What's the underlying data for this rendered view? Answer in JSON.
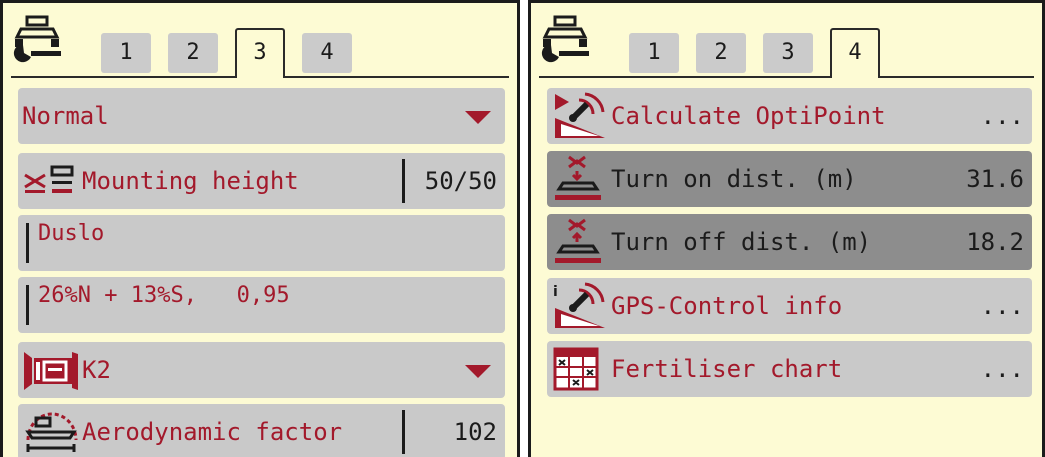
{
  "left_panel": {
    "tabs": [
      "1",
      "2",
      "3",
      "4"
    ],
    "active_tab": "3",
    "rows": {
      "mode": {
        "label": "Normal"
      },
      "mounting_height": {
        "label": "Mounting height",
        "value": "50/50"
      },
      "fertiliser_name": {
        "label": "Duslo"
      },
      "fertiliser_composition": {
        "label": "26%N + 13%S,   0,95"
      },
      "disc_type": {
        "label": "K2"
      },
      "aerodynamic_factor": {
        "label": "Aerodynamic factor",
        "value": "102"
      }
    }
  },
  "right_panel": {
    "tabs": [
      "1",
      "2",
      "3",
      "4"
    ],
    "active_tab": "4",
    "rows": {
      "calculate_optipoint": {
        "label": "Calculate OptiPoint",
        "value": "..."
      },
      "turn_on_dist": {
        "label": "Turn on dist. (m)",
        "value": "31.6"
      },
      "turn_off_dist": {
        "label": "Turn off dist. (m)",
        "value": "18.2"
      },
      "gps_control_info": {
        "label": "GPS-Control info",
        "value": "..."
      },
      "fertiliser_chart": {
        "label": "Fertiliser chart",
        "value": "..."
      }
    }
  },
  "colors": {
    "background": "#fdfbd4",
    "row": "#c9c9c9",
    "row_selected": "#8d8d8d",
    "accent_red": "#a3192b",
    "text_dark": "#1b1b1b"
  },
  "icons": {
    "tab_logo": "spreader-settings-icon",
    "mounting_height": "mounting-height-icon",
    "disc": "spreading-disc-icon",
    "aerodynamic": "aerodynamic-factor-icon",
    "optipoint": "optipoint-calculate-icon",
    "turn_on": "turn-on-distance-icon",
    "turn_off": "turn-off-distance-icon",
    "gps_info": "gps-info-icon",
    "fertiliser_chart": "fertiliser-chart-icon",
    "dropdown": "dropdown-arrow-icon"
  }
}
